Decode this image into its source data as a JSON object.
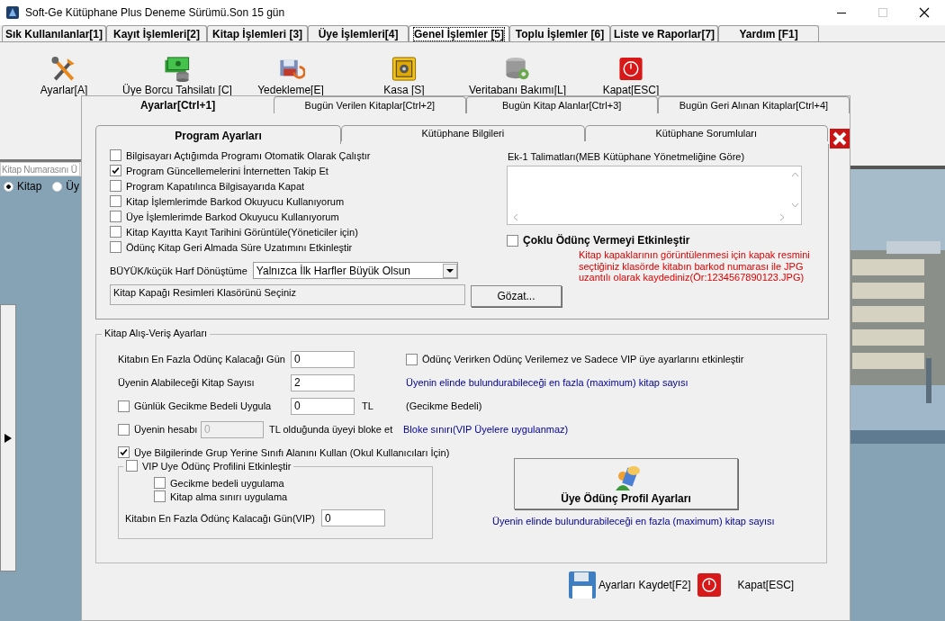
{
  "window": {
    "title": "Soft-Ge Kütüphane Plus Deneme Sürümü.Son 15 gün"
  },
  "main_tabs": [
    {
      "label": "Sık Kullanılanlar[1]",
      "selected": false
    },
    {
      "label": "Kayıt İşlemleri[2]",
      "selected": false
    },
    {
      "label": "Kitap İşlemleri [3]",
      "selected": false
    },
    {
      "label": "Üye İşlemleri[4]",
      "selected": false
    },
    {
      "label": "Genel İşlemler [5]",
      "selected": true
    },
    {
      "label": "Toplu İşlemler [6]",
      "selected": false
    },
    {
      "label": "Liste ve Raporlar[7]",
      "selected": false
    },
    {
      "label": "Yardım [F1]",
      "selected": false
    }
  ],
  "toolbar": [
    {
      "kind": "tools",
      "label": "Ayarlar[A]"
    },
    {
      "kind": "money",
      "label": "Üye Borcu Tahsilatı [C]"
    },
    {
      "kind": "backup",
      "label": "Yedekleme[E]"
    },
    {
      "kind": "safe",
      "label": "Kasa [S]"
    },
    {
      "kind": "database",
      "label": "Veritabanı Bakımı[L]"
    },
    {
      "kind": "power",
      "label": "Kapat[ESC]"
    }
  ],
  "side_panel": {
    "search": {
      "placeholder": "Kitap Numarasını Ü"
    },
    "radios": [
      {
        "label": "Kitap",
        "selected": true
      },
      {
        "label": "Üy",
        "selected": false
      }
    ]
  },
  "dialog": {
    "tabs": [
      {
        "label": "Ayarlar[Ctrl+1]",
        "selected": true
      },
      {
        "label": "Bugün Verilen Kitaplar[Ctrl+2]",
        "selected": false
      },
      {
        "label": "Bugün Kitap Alanlar[Ctrl+3]",
        "selected": false
      },
      {
        "label": "Bugün Geri Alınan Kitaplar[Ctrl+4]",
        "selected": false
      }
    ],
    "inner_tabs": [
      {
        "label": "Program Ayarları",
        "selected": true
      },
      {
        "label": "Kütüphane Bilgileri",
        "selected": false
      },
      {
        "label": "Kütüphane Sorumluları",
        "selected": false
      }
    ],
    "program_settings": {
      "options": [
        {
          "label": "Bilgisayarı Açtığımda Programı Otomatik Olarak Çalıştır",
          "checked": false
        },
        {
          "label": "Program Güncellemelerini İnternetten Takip Et",
          "checked": true
        },
        {
          "label": "Program Kapatılınca Bilgisayarıda Kapat",
          "checked": false
        },
        {
          "label": "Kitap İşlemlerimde Barkod Okuyucu Kullanıyorum",
          "checked": false
        },
        {
          "label": "Üye İşlemlerimde Barkod Okuyucu Kullanıyorum",
          "checked": false
        },
        {
          "label": "Kitap Kayıtta Kayıt Tarihini Görüntüle(Yöneticiler için)",
          "checked": false
        },
        {
          "label": "Ödünç Kitap Geri Almada Süre Uzatımını Etkinleştir",
          "checked": false
        }
      ],
      "instructions_label": "Ek-1 Talimatları(MEB Kütüphane Yönetmeliğine Göre)",
      "multi_loan": {
        "label": "Çoklu Ödünç Vermeyi Etkinleştir",
        "checked": false
      },
      "case_conversion": {
        "label": "BÜYÜK/küçük Harf Dönüştüme",
        "value": "Yalnızca İlk Harfler Büyük Olsun"
      },
      "cover_folder": {
        "value": "Kitap Kapağı Resimleri Klasörünü Seçiniz"
      },
      "browse_button": "Gözat...",
      "cover_note": "Kitap kapaklarının görüntülenmesi için kapak resmini\nseçtiğiniz klasörde kitabın barkod numarası ile JPG\nuzantılı olarak kaydediniz(Ör:1234567890123.JPG)"
    },
    "loan_settings": {
      "title": "Kitap Alış-Veriş Ayarları",
      "rows": [
        {
          "kind": "field",
          "label": "Kitabın En Fazla Ödünç Kalacağı Gün",
          "value": "0",
          "side": {
            "kind": "checkbox",
            "label": "Ödünç Verirken Ödünç Verilemez ve Sadece VIP üye ayarlarını etkinleştir",
            "checked": false
          }
        },
        {
          "kind": "field",
          "label": "Üyenin Alabileceği Kitap Sayısı",
          "value": "2",
          "side": {
            "kind": "hint",
            "text": "Üyenin elinde bulundurabileceği en fazla (maximum) kitap sayısı",
            "color": "#000099"
          }
        },
        {
          "kind": "check_field",
          "label": "Günlük Gecikme Bedeli Uygula",
          "checked": false,
          "value": "0",
          "disabled": false,
          "unit": "TL",
          "side": {
            "kind": "hint",
            "text": "(Gecikme Bedeli)",
            "color": "#000000"
          }
        },
        {
          "kind": "inline_check_field",
          "label": "Üyenin hesabı",
          "checked": false,
          "value": "0",
          "disabled": true,
          "unit": "TL olduğunda üyeyi bloke et",
          "side": {
            "kind": "hint",
            "text": "Bloke sınırı(VIP Üyelere uygulanmaz)",
            "color": "#000099"
          }
        }
      ],
      "class_field": {
        "label": "Üye Bilgilerinde Grup Yerine Sınıfı Alanını Kullan (Okul Kullanıcıları İçin)",
        "checked": true
      },
      "vip": {
        "label": "VIP Uye Ödünç Profilini Etkinleştir",
        "checked": false,
        "options": [
          {
            "label": "Gecikme bedeli uygulama",
            "checked": false
          },
          {
            "label": "Kitap alma sınırı uygulama",
            "checked": false
          }
        ],
        "days": {
          "label": "Kitabın En Fazla Ödünç Kalacağı Gün(VIP)",
          "value": "0"
        }
      },
      "profile_button": "Üye Ödünç Profil Ayarları",
      "profile_hint": "Üyenin elinde bulundurabileceği en fazla (maximum) kitap sayısı"
    },
    "footer": {
      "save": "Ayarları Kaydet[F2]",
      "close": "Kapat[ESC]"
    }
  }
}
